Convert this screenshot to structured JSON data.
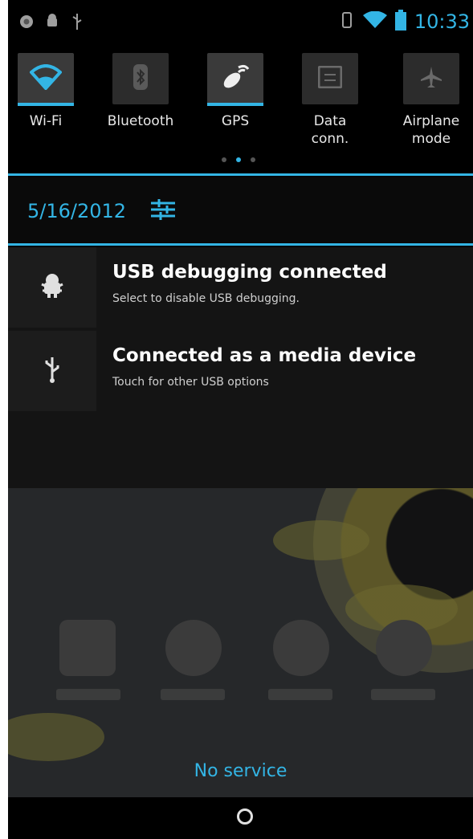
{
  "status_bar": {
    "time": "10:33",
    "left_icons": [
      "chrome-icon",
      "android-icon",
      "usb-icon"
    ],
    "right_icons": [
      "vibrate-icon",
      "wifi-icon",
      "battery-icon"
    ]
  },
  "quick_settings": {
    "tiles": [
      {
        "label": "Wi-Fi",
        "icon": "wifi-icon",
        "on": true
      },
      {
        "label": "Bluetooth",
        "icon": "bluetooth-icon",
        "on": false
      },
      {
        "label": "GPS",
        "icon": "gps-icon",
        "on": true
      },
      {
        "label": "Data conn.",
        "icon": "data-connection-icon",
        "on": false
      },
      {
        "label": "Airplane\nmode",
        "icon": "airplane-icon",
        "on": false
      }
    ],
    "page_count": 3,
    "active_page": 1
  },
  "date_bar": {
    "date": "5/16/2012",
    "settings_icon": "settings-sliders-icon"
  },
  "notifications": [
    {
      "title": "USB debugging connected",
      "subtitle": "Select to disable USB debugging.",
      "icon": "android-debug-icon"
    },
    {
      "title": "Connected as a media device",
      "subtitle": "Touch for other USB options",
      "icon": "usb-icon"
    }
  ],
  "home_screen": {
    "carrier_status": "No service"
  },
  "colors": {
    "accent": "#33b5e5",
    "background": "#000000"
  }
}
